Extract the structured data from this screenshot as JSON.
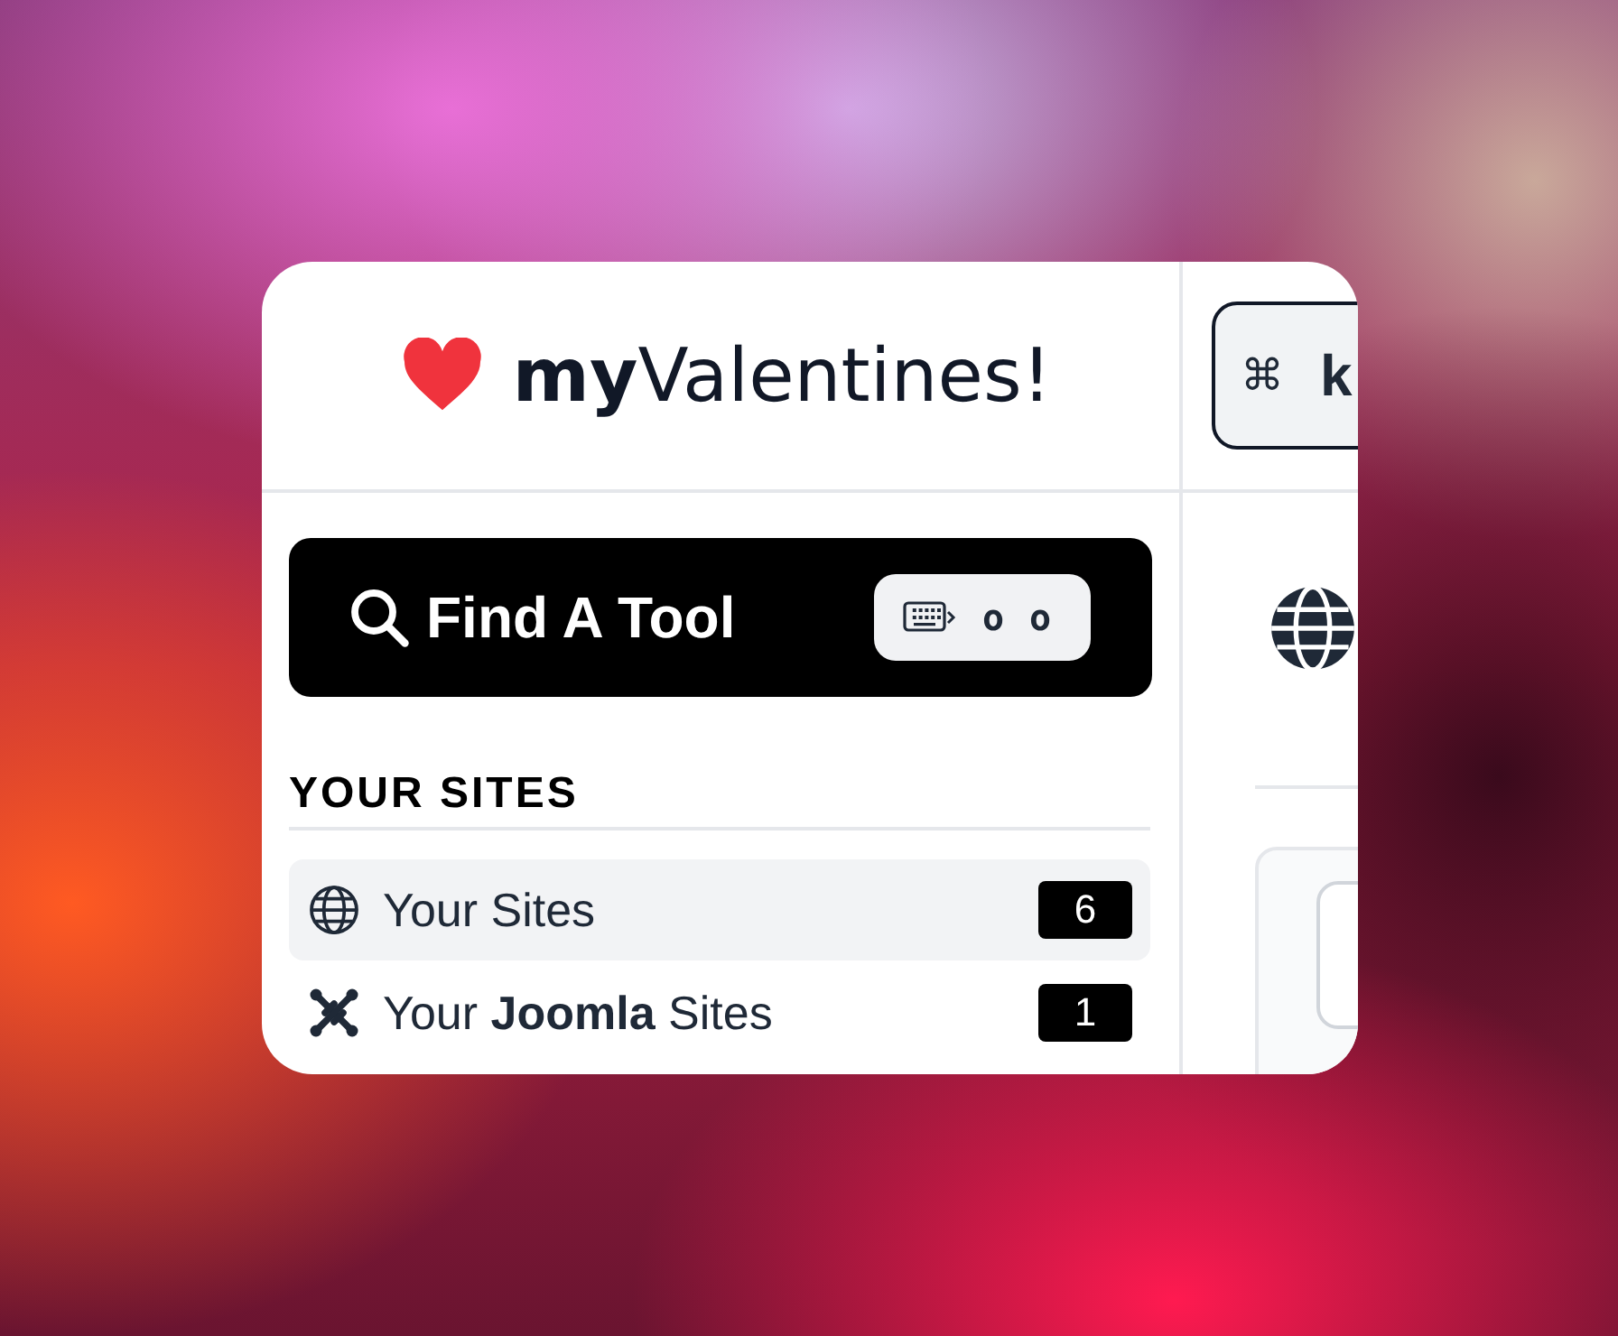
{
  "logo": {
    "text": "**my**Valentines!"
  },
  "shortcut_button": {
    "symbol": "⌘",
    "key": "k"
  },
  "find_tool": {
    "label": "Find A Tool",
    "keys": [
      "o",
      "o"
    ]
  },
  "sidebar": {
    "heading": "YOUR SITES",
    "items": [
      {
        "kind": "globe",
        "label": "Your Sites",
        "count": "6",
        "selected": true
      },
      {
        "kind": "joomla",
        "label": "Your **Joomla** Sites",
        "count": "1",
        "selected": false
      }
    ]
  }
}
